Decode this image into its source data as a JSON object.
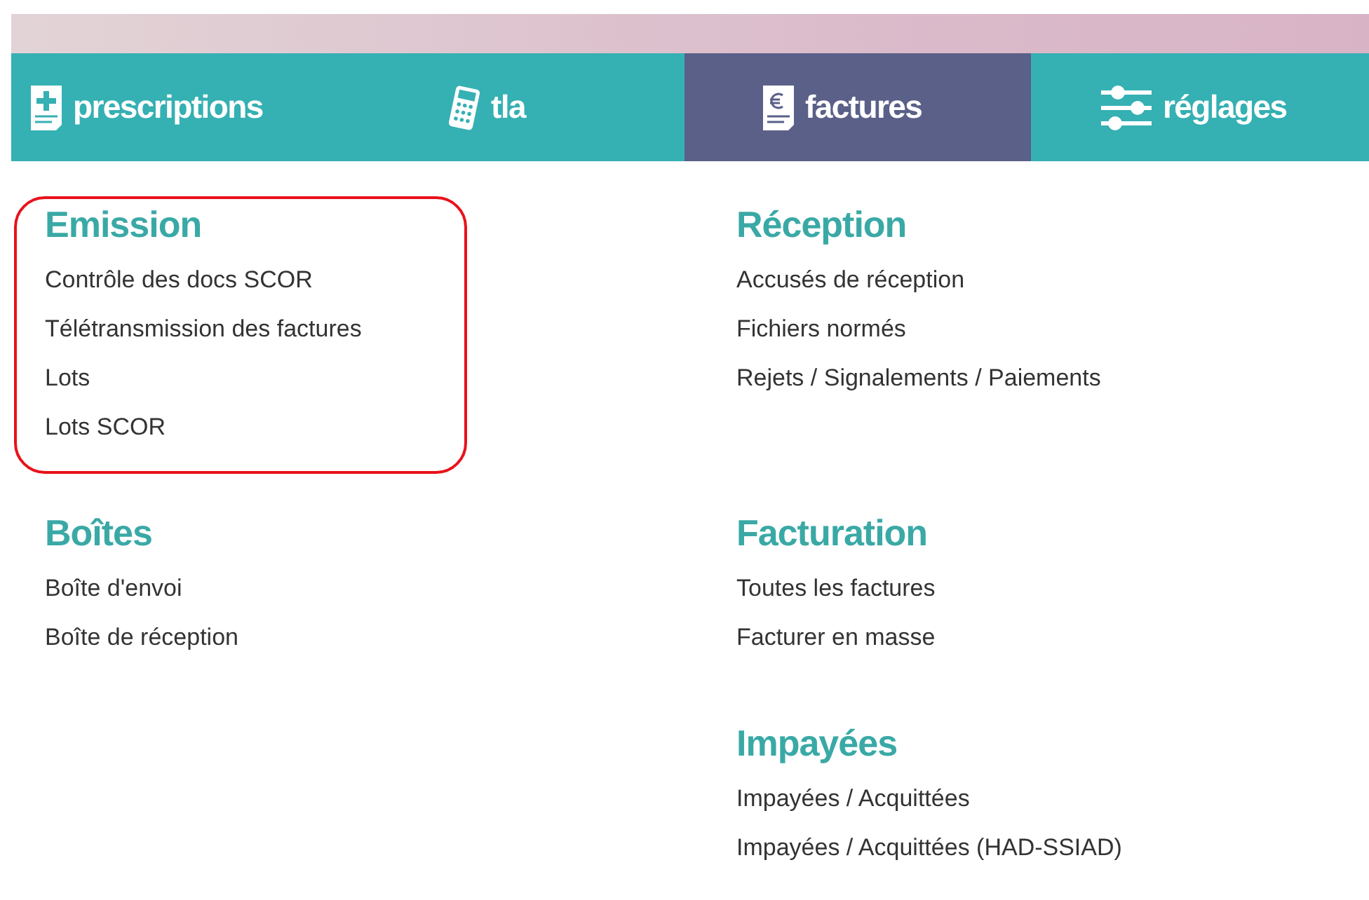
{
  "tabs": [
    {
      "label": "prescriptions",
      "kind": "prescription",
      "selected": false
    },
    {
      "label": "tla",
      "kind": "calculator",
      "selected": false
    },
    {
      "label": "factures",
      "kind": "invoice",
      "selected": true
    },
    {
      "label": "réglages",
      "kind": "sliders",
      "selected": false
    }
  ],
  "section_rows": [
    {
      "left": {
        "title": "Emission",
        "highlighted": true,
        "items": [
          "Contrôle des docs SCOR",
          "Télétransmission des factures",
          "Lots",
          "Lots SCOR"
        ]
      },
      "right": {
        "title": "Réception",
        "highlighted": false,
        "items": [
          "Accusés de réception",
          "Fichiers normés",
          "Rejets / Signalements / Paiements"
        ]
      }
    },
    {
      "left": {
        "title": "Boîtes",
        "highlighted": false,
        "items": [
          "Boîte d'envoi",
          "Boîte de réception"
        ]
      },
      "right": {
        "title": "Facturation",
        "highlighted": false,
        "items": [
          "Toutes les factures",
          "Facturer en masse"
        ]
      }
    },
    {
      "right": {
        "title": "Impayées",
        "highlighted": false,
        "items": [
          "Impayées / Acquittées",
          "Impayées / Acquittées (HAD-SSIAD)"
        ]
      }
    }
  ]
}
